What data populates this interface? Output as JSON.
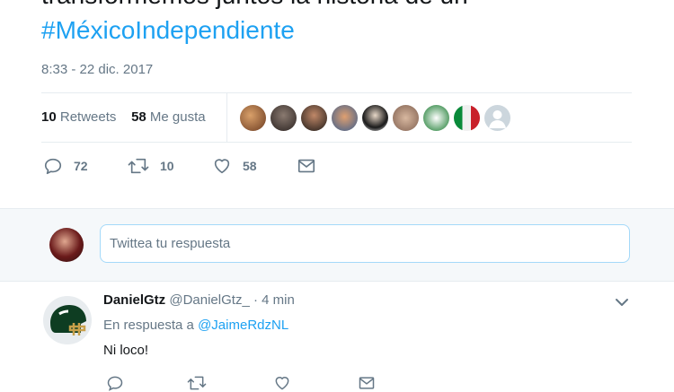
{
  "tweet": {
    "text_partial": "transformemos juntos la historia de un",
    "hashtag": "#MéxicoIndependiente",
    "timestamp": "8:33 - 22 dic. 2017"
  },
  "stats": {
    "retweets_count": "10",
    "retweets_label": "Retweets",
    "likes_count": "58",
    "likes_label": "Me gusta"
  },
  "actions": {
    "replies": "72",
    "retweets": "10",
    "likes": "58"
  },
  "reply_box": {
    "placeholder": "Twittea tu respuesta"
  },
  "reply": {
    "name": "DanielGtz",
    "handle": "@DanielGtz_",
    "time": "· 4 min",
    "in_reply_label": "En respuesta a",
    "in_reply_mention": "@JaimeRdzNL",
    "text": "Ni loco!"
  },
  "colors": {
    "accent": "#1da1f2",
    "muted": "#657786",
    "background_bar": "#f5f8fa"
  }
}
